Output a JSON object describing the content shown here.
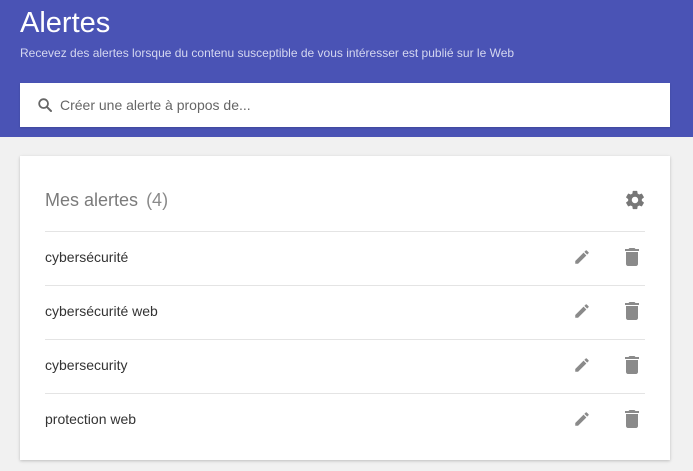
{
  "header": {
    "title": "Alertes",
    "subtitle": "Recevez des alertes lorsque du contenu susceptible de vous intéresser est publié sur le Web",
    "background_color": "#4a53b5"
  },
  "search": {
    "placeholder": "Créer une alerte à propos de...",
    "value": "",
    "icon": "search-icon"
  },
  "alerts_card": {
    "heading": "Mes alertes",
    "count": "(4)",
    "settings_icon": "gear-icon",
    "items": [
      {
        "label": "cybersécurité",
        "edit_icon": "pencil-icon",
        "delete_icon": "trash-icon"
      },
      {
        "label": "cybersécurité web",
        "edit_icon": "pencil-icon",
        "delete_icon": "trash-icon"
      },
      {
        "label": "cybersecurity",
        "edit_icon": "pencil-icon",
        "delete_icon": "trash-icon"
      },
      {
        "label": "protection web",
        "edit_icon": "pencil-icon",
        "delete_icon": "trash-icon"
      }
    ]
  }
}
